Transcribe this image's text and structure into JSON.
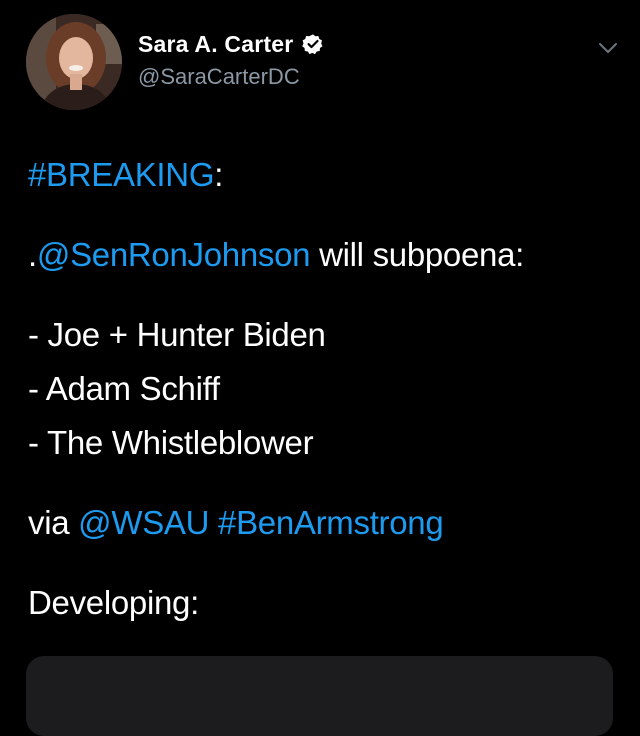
{
  "author": {
    "display_name": "Sara A. Carter",
    "handle": "@SaraCarterDC",
    "verified": true,
    "verified_color": "#ffffff"
  },
  "icons": {
    "verified": "verified-badge-icon",
    "more": "chevron-down-icon"
  },
  "tweet": {
    "breaking_tag": "#BREAKING",
    "breaking_colon": ":",
    "mention_prefix": ".",
    "mention": "@SenRonJohnson",
    "mention_suffix": " will subpoena:",
    "list_items": [
      "- Joe + Hunter Biden",
      "- Adam Schiff",
      "- The Whistleblower"
    ],
    "via_prefix": "via ",
    "via_mention": "@WSAU",
    "via_space": " ",
    "via_hashtag": "#BenArmstrong",
    "closing": "Developing:"
  },
  "colors": {
    "background": "#000000",
    "text": "#ffffff",
    "link": "#1d9bf0",
    "secondary": "#8b98a5"
  }
}
